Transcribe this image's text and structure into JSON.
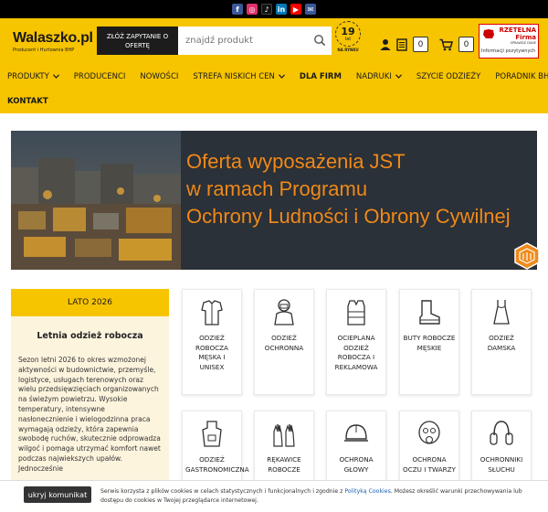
{
  "social": [
    {
      "icon": "facebook-icon",
      "glyph": "f",
      "color": "#3b5998"
    },
    {
      "icon": "instagram-icon",
      "glyph": "◎",
      "color": "#e1306c"
    },
    {
      "icon": "tiktok-icon",
      "glyph": "♪",
      "color": "#111111"
    },
    {
      "icon": "linkedin-icon",
      "glyph": "in",
      "color": "#0077b5"
    },
    {
      "icon": "youtube-icon",
      "glyph": "▶",
      "color": "#ff0000"
    },
    {
      "icon": "email-icon",
      "glyph": "✉",
      "color": "#3b5998"
    }
  ],
  "header": {
    "logo_title": "Walaszko.pl",
    "logo_sub": "Producent i Hurtownia BHP",
    "quote_button": "ZŁÓŻ ZAPYTANIE O OFERTĘ",
    "search_placeholder": "znajdź produkt",
    "years_badge": {
      "number": "19",
      "unit": "lat",
      "text": "NA RYNKU"
    },
    "wishlist_count": "0",
    "cart_count": "0",
    "rzetelna": {
      "title": "RZETELNA Firma",
      "sub": "SPRAWDŹ DANE",
      "info": "Informacji pozytywnych"
    }
  },
  "nav": {
    "row1": [
      {
        "label": "PRODUKTY",
        "chevron": true
      },
      {
        "label": "PRODUCENCI",
        "chevron": false
      },
      {
        "label": "NOWOŚCI",
        "chevron": false
      },
      {
        "label": "STREFA NISKICH CEN",
        "chevron": true
      },
      {
        "label": "DLA FIRM",
        "chevron": false,
        "bold": true
      },
      {
        "label": "NADRUKI",
        "chevron": true
      },
      {
        "label": "SZYCIE ODZIEŻY",
        "chevron": false
      },
      {
        "label": "PORADNIK BHP",
        "chevron": true
      }
    ],
    "row2": [
      {
        "label": "KONTAKT",
        "bold": true
      }
    ]
  },
  "hero": {
    "lines": [
      "Oferta wyposażenia JST",
      "w ramach Programu",
      "Ochrony Ludności i Obrony Cywilnej"
    ]
  },
  "promo": {
    "header": "LATO 2026",
    "title": "Letnia odzież robocza",
    "body": "Sezon letni 2026 to okres wzmożonej aktywności w budownictwie, przemyśle, logistyce, usługach terenowych oraz wielu przedsięwzięciach organizowanych na świeżym powietrzu. Wysokie temperatury, intensywne nasłonecznienie i wielogodzinna praca wymagają odzieży, która zapewnia swobodę ruchów, skutecznie odprowadza wilgoć i pomaga utrzymać komfort nawet podczas najwiekszych upałów. Jednocześnie"
  },
  "categories": [
    {
      "label": "ODZIEŻ ROBOCZA MĘSKA I UNISEX",
      "icon": "workwear-icon"
    },
    {
      "label": "ODZIEŻ OCHRONNA",
      "icon": "protective-suit-icon"
    },
    {
      "label": "OCIEPLANA ODZIEŻ ROBOCZA I REKLAMOWA",
      "icon": "vest-icon"
    },
    {
      "label": "BUTY ROBOCZE MĘSKIE",
      "icon": "boot-icon"
    },
    {
      "label": "ODZIEŻ DAMSKA",
      "icon": "dress-icon"
    },
    {
      "label": "ODZIEŻ GASTRONOMICZNA",
      "icon": "apron-icon"
    },
    {
      "label": "RĘKAWICE ROBOCZE",
      "icon": "gloves-icon"
    },
    {
      "label": "OCHRONA GŁOWY",
      "icon": "helmet-icon"
    },
    {
      "label": "OCHRONA OCZU I TWARZY",
      "icon": "gas-mask-icon"
    },
    {
      "label": "OCHRONNIKI SŁUCHU",
      "icon": "earmuffs-icon"
    }
  ],
  "cookie": {
    "button": "ukryj komunikat",
    "text_before": "Serwis korzysta z plików cookies w celach statystycznych i funkcjonalnych i zgodnie z ",
    "link": "Polityką Cookies",
    "text_after": ". Możesz określić warunki przechowywania lub dostępu do cookies w Twojej przeglądarce internetowej."
  },
  "colors": {
    "accent": "#f7c400",
    "hero_text": "#f08a1b",
    "dark": "#1c1c1c",
    "promo_bg": "#fdf4de"
  }
}
